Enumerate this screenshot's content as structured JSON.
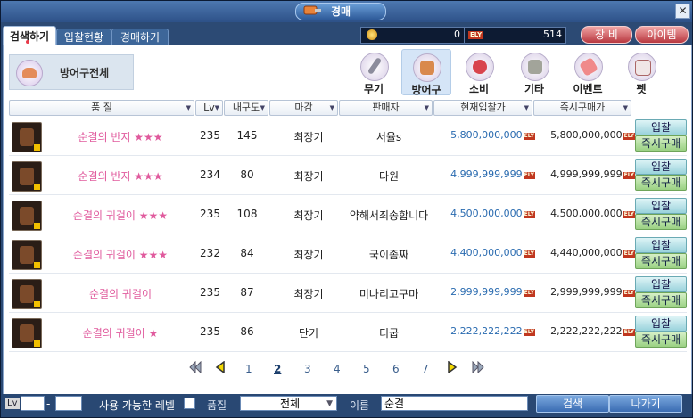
{
  "window": {
    "title": "경매"
  },
  "tabs": [
    {
      "label": "검색하기"
    },
    {
      "label": "입찰현황"
    },
    {
      "label": "경매하기"
    }
  ],
  "wallet": {
    "points_value": "0",
    "ely_label": "ELY",
    "ely_value": "514"
  },
  "header_buttons": {
    "equipment": "장 비",
    "item": "아이템"
  },
  "category": {
    "current": "방어구전체"
  },
  "categories": [
    {
      "label": "무기"
    },
    {
      "label": "방어구"
    },
    {
      "label": "소비"
    },
    {
      "label": "기타"
    },
    {
      "label": "이벤트"
    },
    {
      "label": "펫"
    }
  ],
  "columns": {
    "grade": "품 질",
    "lv": "Lv",
    "durability": "내구도",
    "deadline": "마감",
    "seller": "판매자",
    "current_bid": "현재입찰가",
    "buyout": "즉시구매가"
  },
  "row_buttons": {
    "bid": "입찰",
    "buy": "즉시구매"
  },
  "rows": [
    {
      "name": "순결의 반지 ★★★",
      "lv": "235",
      "durability": "145",
      "deadline": "최장기",
      "seller": "서율s",
      "bid": "5,800,000,000",
      "buyout": "5,800,000,000"
    },
    {
      "name": "순결의 반지 ★★★",
      "lv": "234",
      "durability": "80",
      "deadline": "최장기",
      "seller": "다원",
      "bid": "4,999,999,999",
      "buyout": "4,999,999,999"
    },
    {
      "name": "순결의 귀걸이 ★★★",
      "lv": "235",
      "durability": "108",
      "deadline": "최장기",
      "seller": "약해서죄송합니다",
      "bid": "4,500,000,000",
      "buyout": "4,500,000,000"
    },
    {
      "name": "순결의 귀걸이 ★★★",
      "lv": "232",
      "durability": "84",
      "deadline": "최장기",
      "seller": "국이좀짜",
      "bid": "4,400,000,000",
      "buyout": "4,440,000,000"
    },
    {
      "name": "순결의 귀걸이",
      "lv": "235",
      "durability": "87",
      "deadline": "최장기",
      "seller": "미나리고구마",
      "bid": "2,999,999,999",
      "buyout": "2,999,999,999"
    },
    {
      "name": "순결의 귀걸이 ★",
      "lv": "235",
      "durability": "86",
      "deadline": "단기",
      "seller": "티굽",
      "bid": "2,222,222,222",
      "buyout": "2,222,222,222"
    }
  ],
  "pagination": {
    "pages": [
      "1",
      "2",
      "3",
      "4",
      "5",
      "6",
      "7"
    ],
    "current": "2"
  },
  "filters": {
    "lv_label": "Lv",
    "lv_min": "",
    "lv_max": "",
    "usable_level_label": "사용 가능한 레벨",
    "grade_label": "품질",
    "grade_value": "전체",
    "name_label": "이름",
    "name_value": "순결",
    "search_button": "검색",
    "exit_button": "나가기"
  }
}
